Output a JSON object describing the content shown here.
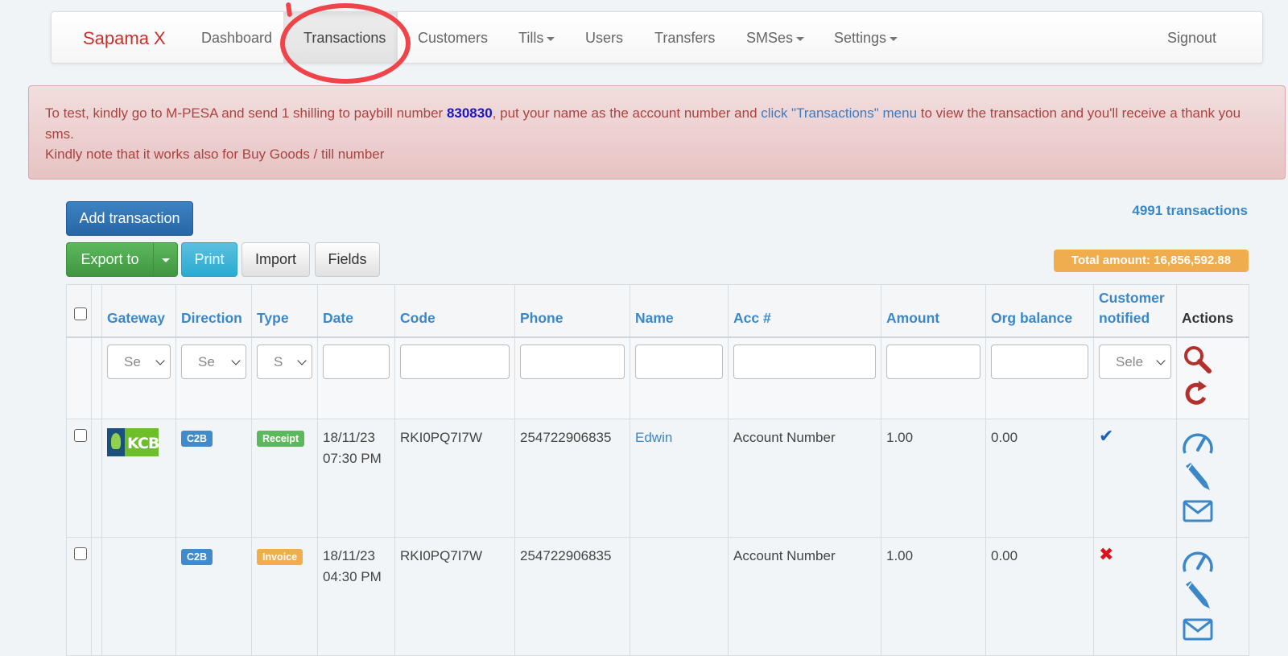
{
  "navbar": {
    "brand": "Sapama X",
    "items": [
      {
        "label": "Dashboard"
      },
      {
        "label": "Transactions"
      },
      {
        "label": "Customers"
      },
      {
        "label": "Tills"
      },
      {
        "label": "Users"
      },
      {
        "label": "Transfers"
      },
      {
        "label": "SMSes"
      },
      {
        "label": "Settings"
      }
    ],
    "signout": "Signout"
  },
  "alert": {
    "text_1": "To test, kindly go to M-PESA and send 1 shilling to paybill number ",
    "paybill": "830830",
    "text_2": ", put your name as the account number and ",
    "link": "click \"Transactions\" menu",
    "text_3": " to view the transaction and you'll receive a thank you sms.",
    "note": "Kindly note that it works also for Buy Goods / till number"
  },
  "toolbar": {
    "add_label": "Add transaction",
    "export_label": "Export to",
    "print_label": "Print",
    "import_label": "Import",
    "fields_label": "Fields"
  },
  "summary": {
    "count": "4991 transactions",
    "total": "Total amount: 16,856,592.88"
  },
  "table": {
    "headers": {
      "gateway": "Gateway",
      "direction": "Direction",
      "type": "Type",
      "date": "Date",
      "code": "Code",
      "phone": "Phone",
      "name": "Name",
      "acc": "Acc #",
      "amount": "Amount",
      "org_balance": "Org balance",
      "customer_notified": "Customer notified",
      "actions": "Actions"
    },
    "filters": {
      "gateway": "Se",
      "direction": "Se",
      "type": "S",
      "customer_notified": "Sele"
    },
    "rows": [
      {
        "gateway_logo": "KCB",
        "direction": "C2B",
        "type": "Receipt",
        "date": "18/11/23",
        "time": "07:30 PM",
        "code": "RKI0PQ7I7W",
        "phone": "254722906835",
        "name": "Edwin",
        "acc": "Account Number",
        "amount": "1.00",
        "org_balance": "0.00",
        "notified": "✔"
      },
      {
        "gateway_logo": "",
        "direction": "C2B",
        "type": "Invoice",
        "date": "18/11/23",
        "time": "04:30 PM",
        "code": "RKI0PQ7I7W",
        "phone": "254722906835",
        "name": "",
        "acc": "Account Number",
        "amount": "1.00",
        "org_balance": "0.00",
        "notified": "✖"
      }
    ]
  },
  "colors": {
    "brand": "#c9302c",
    "link": "#3b87c8",
    "alert_text": "#a94442",
    "annotation_circle": "#f0444b"
  }
}
